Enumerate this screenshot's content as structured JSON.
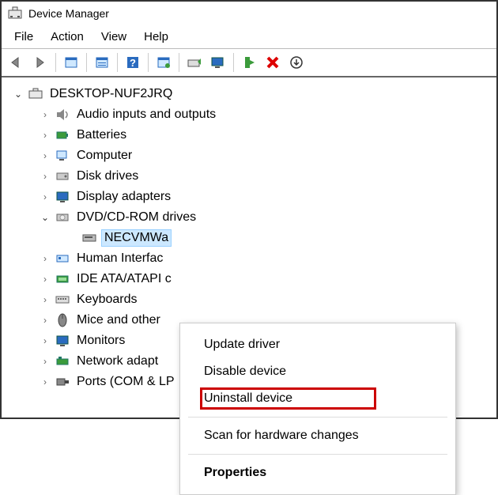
{
  "window": {
    "title": "Device Manager"
  },
  "menubar": [
    "File",
    "Action",
    "View",
    "Help"
  ],
  "toolbar_icons": [
    "back-icon",
    "forward-icon",
    "show-hidden-icon",
    "properties-icon",
    "help-icon",
    "scan-icon",
    "update-icon",
    "monitor-icon",
    "enable-icon",
    "delete-icon",
    "eject-icon"
  ],
  "tree": {
    "root": {
      "label": "DESKTOP-NUF2JRQ",
      "expanded": true
    },
    "nodes": [
      {
        "label": "Audio inputs and outputs",
        "expanded": false,
        "icon": "speaker-icon"
      },
      {
        "label": "Batteries",
        "expanded": false,
        "icon": "battery-icon"
      },
      {
        "label": "Computer",
        "expanded": false,
        "icon": "computer-icon"
      },
      {
        "label": "Disk drives",
        "expanded": false,
        "icon": "disk-icon"
      },
      {
        "label": "Display adapters",
        "expanded": false,
        "icon": "display-icon"
      },
      {
        "label": "DVD/CD-ROM drives",
        "expanded": true,
        "icon": "dvd-icon",
        "children": [
          {
            "label": "NECVMWa",
            "icon": "dvd-device-icon",
            "selected": true
          }
        ]
      },
      {
        "label": "Human Interfac",
        "expanded": false,
        "icon": "hid-icon"
      },
      {
        "label": "IDE ATA/ATAPI c",
        "expanded": false,
        "icon": "ide-icon"
      },
      {
        "label": "Keyboards",
        "expanded": false,
        "icon": "keyboard-icon"
      },
      {
        "label": "Mice and other",
        "expanded": false,
        "icon": "mouse-icon"
      },
      {
        "label": "Monitors",
        "expanded": false,
        "icon": "monitor-icon"
      },
      {
        "label": "Network adapt",
        "expanded": false,
        "icon": "network-icon"
      },
      {
        "label": "Ports (COM & LP",
        "expanded": false,
        "icon": "port-icon"
      }
    ]
  },
  "context_menu": {
    "items": [
      {
        "label": "Update driver",
        "type": "item"
      },
      {
        "label": "Disable device",
        "type": "item"
      },
      {
        "label": "Uninstall device",
        "type": "item",
        "highlight": true
      },
      {
        "type": "sep"
      },
      {
        "label": "Scan for hardware changes",
        "type": "item"
      },
      {
        "type": "sep"
      },
      {
        "label": "Properties",
        "type": "item",
        "bold": true
      }
    ]
  }
}
